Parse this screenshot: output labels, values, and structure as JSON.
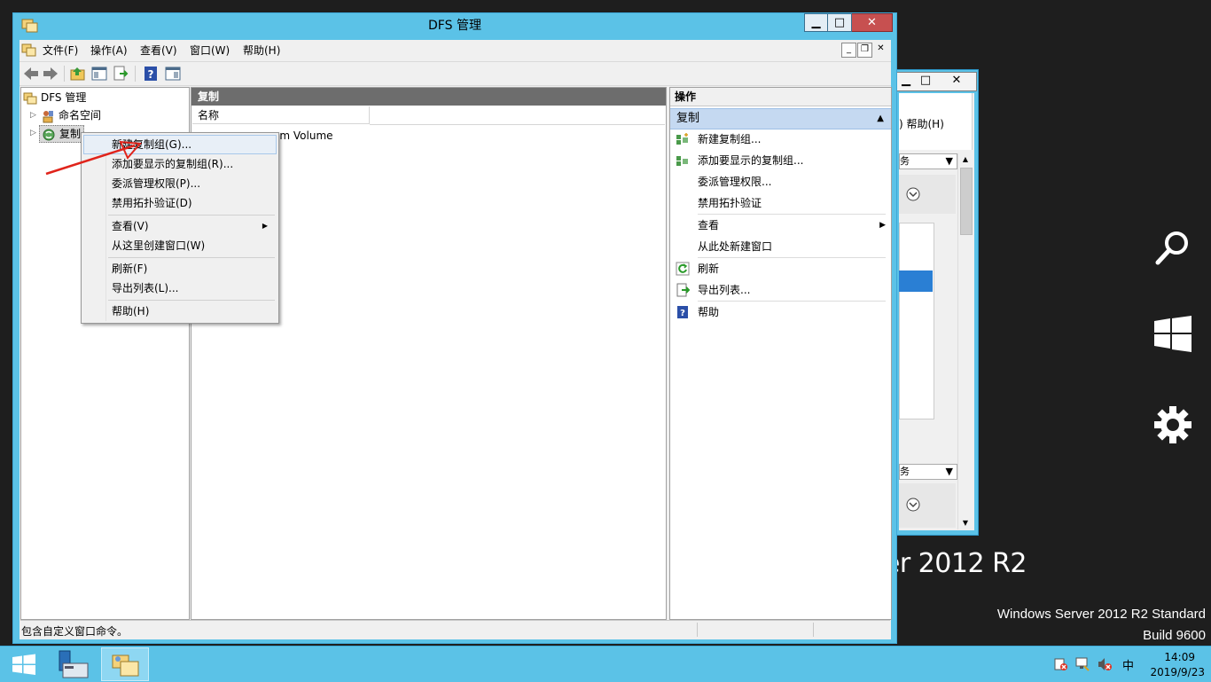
{
  "window": {
    "title": "DFS 管理",
    "minimize": "▁",
    "maximize": "□",
    "close": "✕"
  },
  "menubar": {
    "items": [
      "文件(F)",
      "操作(A)",
      "查看(V)",
      "窗口(W)",
      "帮助(H)"
    ]
  },
  "tree": {
    "root": "DFS 管理",
    "items": [
      {
        "label": "命名空间"
      },
      {
        "label": "复制"
      }
    ]
  },
  "center": {
    "header": "复制",
    "column_name": "名称",
    "row_fragment": "em Volume"
  },
  "actions_pane": {
    "title": "操作",
    "section": "复制",
    "items": [
      {
        "label": "新建复制组...",
        "icon": "new-replication-group-icon"
      },
      {
        "label": "添加要显示的复制组...",
        "icon": "add-replication-group-icon"
      },
      {
        "label": "委派管理权限...",
        "icon": ""
      },
      {
        "label": "禁用拓扑验证",
        "icon": ""
      },
      {
        "label": "查看",
        "icon": "",
        "submenu": true
      },
      {
        "label": "从此处新建窗口",
        "icon": ""
      },
      {
        "label": "刷新",
        "icon": "refresh-icon"
      },
      {
        "label": "导出列表...",
        "icon": "export-icon"
      },
      {
        "label": "帮助",
        "icon": "help-icon"
      }
    ]
  },
  "context_menu": {
    "items": [
      "新建复制组(G)...",
      "添加要显示的复制组(R)...",
      "委派管理权限(P)...",
      "禁用拓扑验证(D)",
      "查看(V)",
      "从这里创建窗口(W)",
      "刷新(F)",
      "导出列表(L)...",
      "帮助(H)"
    ],
    "highlighted_index": 0
  },
  "status_bar": {
    "text": "包含自定义窗口命令。"
  },
  "background_window": {
    "menu_fragment": ")  帮助(H)",
    "dropdown_fragment": "务"
  },
  "desktop": {
    "watermark_large": "erver 2012 R2",
    "edition": "Windows Server 2012 R2 Standard",
    "build": "Build 9600"
  },
  "taskbar": {
    "time": "14:09",
    "date": "2019/9/23",
    "ime": "中"
  },
  "colors": {
    "window_frame": "#5bc2e7",
    "close_button": "#c75050",
    "pane_header": "#6d6d6d",
    "action_section": "#c5d9f1",
    "arrow_annotation": "#e0241b"
  }
}
